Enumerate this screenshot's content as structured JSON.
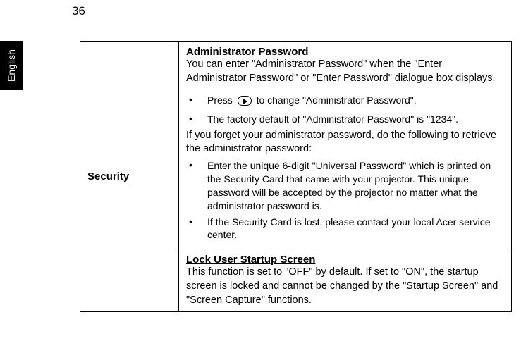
{
  "page_number": "36",
  "language_tab": "English",
  "table": {
    "row_label": "Security",
    "cell1": {
      "heading": "Administrator Password",
      "intro": "You can enter \"Administrator Password\" when the \"Enter Administrator Password\" or \"Enter Password\" dialogue box displays.",
      "bullet1_pre": "Press ",
      "bullet1_post": " to change \"Administrator Password\".",
      "bullet2": "The factory default of \"Administrator Password\" is \"1234\".",
      "forgot": "If you forget your administrator password, do the following to retrieve the administrator password:",
      "bullet3": "Enter the unique 6-digit \"Universal Password\" which is printed on the Security Card that came with your projector. This unique password will be accepted by the projector no matter what the administrator password is.",
      "bullet4": "If the Security Card is lost, please contact your local Acer service center."
    },
    "cell2": {
      "heading": "Lock User Startup Screen",
      "body": "This function is set to \"OFF\" by default. If set to \"ON\", the startup screen is locked and cannot be changed by the \"Startup Screen\" and \"Screen Capture\" functions."
    }
  }
}
